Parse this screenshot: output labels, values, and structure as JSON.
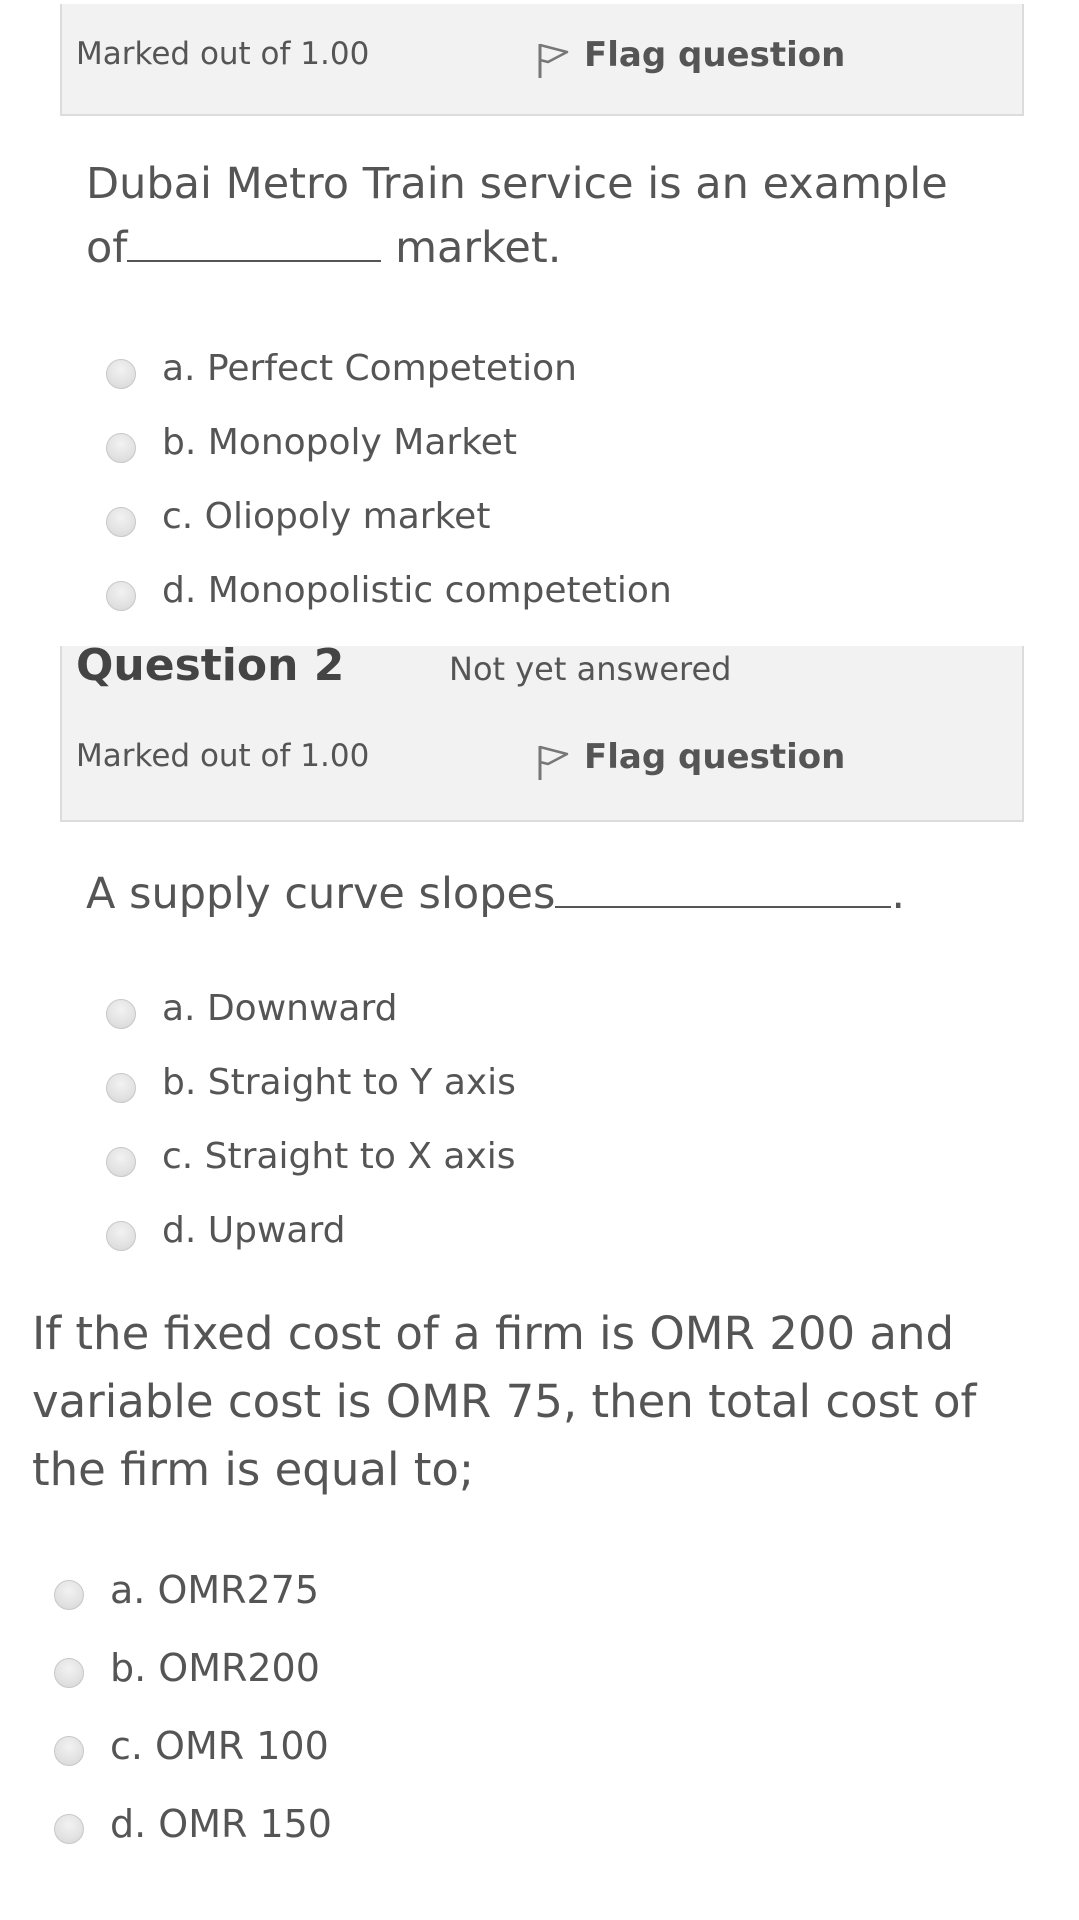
{
  "question1": {
    "marked_out_of": "Marked out of 1.00",
    "flag_label": "Flag question",
    "text_before": "Dubai Metro Train service is an example of",
    "text_after": " market.",
    "options": [
      "a. Perfect Competetion",
      "b. Monopoly Market",
      "c. Oliopoly market",
      "d. Monopolistic competetion"
    ]
  },
  "question2": {
    "title": "Question 2",
    "status": "Not yet answered",
    "marked_out_of": "Marked out of 1.00",
    "flag_label": "Flag question",
    "text_before": "A supply curve slopes",
    "text_after": ".",
    "options": [
      "a. Downward",
      "b. Straight to Y axis",
      "c. Straight to X axis",
      "d. Upward"
    ]
  },
  "question3": {
    "text": "If the fixed cost of a firm is OMR 200 and variable cost is OMR 75, then total cost of the firm is equal to;",
    "options": [
      "a. OMR275",
      "b. OMR200",
      "c. OMR 100",
      "d. OMR 150"
    ]
  },
  "icons": {
    "flag": "flag-icon",
    "radio": "radio-button"
  },
  "colors": {
    "info_box_bg": "#f2f2f2",
    "text": "#555555"
  }
}
